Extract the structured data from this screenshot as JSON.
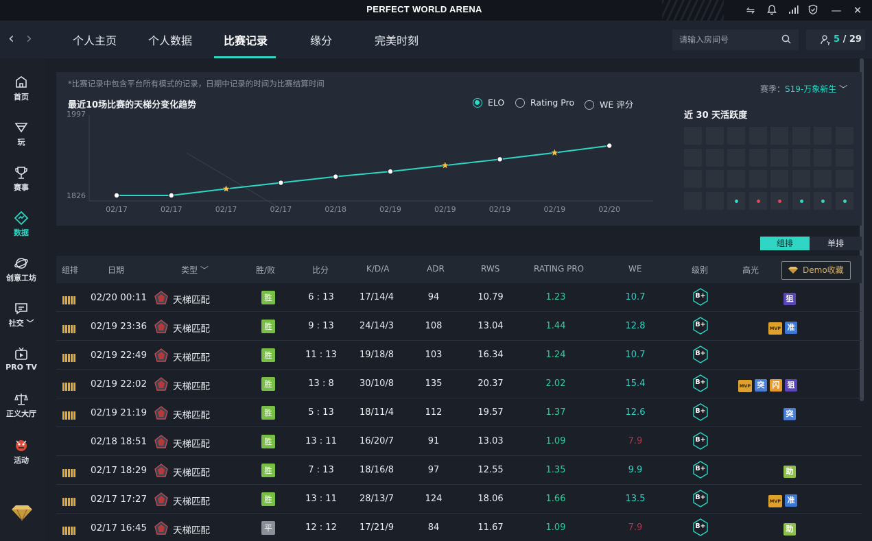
{
  "window": {
    "title": "PERFECT WORLD ARENA"
  },
  "nav": {
    "tabs": [
      {
        "label": "个人主页"
      },
      {
        "label": "个人数据"
      },
      {
        "label": "比赛记录"
      },
      {
        "label": "缘分"
      },
      {
        "label": "完美时刻"
      }
    ],
    "active_tab": "比赛记录",
    "room_search_placeholder": "请输入房间号",
    "online_count": "5",
    "online_total": "29"
  },
  "sidebar": {
    "items": [
      {
        "label": "首页",
        "icon": "home-icon"
      },
      {
        "label": "玩",
        "icon": "play-icon"
      },
      {
        "label": "赛事",
        "icon": "trophy-icon"
      },
      {
        "label": "数据",
        "icon": "data-icon"
      },
      {
        "label": "创意工坊",
        "icon": "workshop-icon"
      },
      {
        "label": "社交",
        "icon": "chat-icon"
      },
      {
        "label": "PRO TV",
        "icon": "tv-icon"
      },
      {
        "label": "正义大厅",
        "icon": "scales-icon"
      },
      {
        "label": "活动",
        "icon": "event-icon"
      }
    ],
    "active": "数据"
  },
  "chart_panel": {
    "note": "*比赛记录中包含平台所有模式的记录，日期中记录的时间为比赛结算时间",
    "title": "最近10场比赛的天梯分变化趋势",
    "radio_options": [
      "ELO",
      "Rating Pro",
      "WE 评分"
    ],
    "radio_selected": "ELO",
    "season_label": "赛季：",
    "season_value": "S19-万象新生",
    "activity_title": "近 30 天活跃度",
    "activity_cells": [
      "none",
      "none",
      "none",
      "none",
      "none",
      "none",
      "none",
      "none",
      "none",
      "none",
      "none",
      "none",
      "none",
      "none",
      "none",
      "none",
      "none",
      "none",
      "none",
      "none",
      "none",
      "none",
      "none",
      "none",
      "none",
      "none",
      "green",
      "red",
      "red",
      "green",
      "green",
      "green"
    ],
    "colors": {
      "accent": "#2ed6c3",
      "win_dot": "#2ed6c3",
      "loss_dot": "#e0475a"
    }
  },
  "chart_data": {
    "type": "line",
    "title": "最近10场比赛的天梯分变化趋势",
    "x": [
      "02/17",
      "02/17",
      "02/17",
      "02/17",
      "02/18",
      "02/19",
      "02/19",
      "02/19",
      "02/19",
      "02/20"
    ],
    "series": [
      {
        "values": [
          1826,
          1826,
          1840,
          1853,
          1866,
          1877,
          1890,
          1903,
          1917,
          1932
        ],
        "stars": [
          false,
          false,
          true,
          false,
          false,
          false,
          true,
          false,
          true,
          false
        ]
      }
    ],
    "y_tick_labels": [
      "1997",
      "1826"
    ],
    "ylim": [
      1826,
      1997
    ]
  },
  "mode_toggle": {
    "options": [
      "组排",
      "单排"
    ],
    "selected": "组排"
  },
  "table": {
    "headers": {
      "group": "组排",
      "date": "日期",
      "type": "类型",
      "result": "胜/败",
      "score": "比分",
      "kda": "K/D/A",
      "adr": "ADR",
      "rws": "RWS",
      "rating": "RATING PRO",
      "we": "WE",
      "level": "级别",
      "highlight": "高光"
    },
    "demo_button": "Demo收藏",
    "rows": [
      {
        "group": true,
        "date": "02/20 00:11",
        "type": "天梯匹配",
        "result": "胜",
        "score": "6 : 13",
        "kda": "17/14/4",
        "adr": "94",
        "rws": "10.79",
        "rating": "1.23",
        "we": "10.7",
        "we_low": false,
        "level": "B+",
        "tags": [
          {
            "t": "zu",
            "label": "狙"
          }
        ]
      },
      {
        "group": true,
        "date": "02/19 23:36",
        "type": "天梯匹配",
        "result": "胜",
        "score": "9 : 13",
        "kda": "24/14/3",
        "adr": "108",
        "rws": "13.04",
        "rating": "1.44",
        "we": "12.8",
        "we_low": false,
        "level": "B+",
        "tags": [
          {
            "t": "mvp",
            "label": "MVP"
          },
          {
            "t": "yan",
            "label": "准"
          }
        ]
      },
      {
        "group": true,
        "date": "02/19 22:49",
        "type": "天梯匹配",
        "result": "胜",
        "score": "11 : 13",
        "kda": "19/18/8",
        "adr": "103",
        "rws": "16.34",
        "rating": "1.24",
        "we": "10.7",
        "we_low": false,
        "level": "B+",
        "tags": []
      },
      {
        "group": true,
        "date": "02/19 22:02",
        "type": "天梯匹配",
        "result": "胜",
        "score": "13 : 8",
        "kda": "30/10/8",
        "adr": "135",
        "rws": "20.37",
        "rating": "2.02",
        "we": "15.4",
        "we_low": false,
        "level": "B+",
        "tags": [
          {
            "t": "mvp",
            "label": "MVP"
          },
          {
            "t": "tu",
            "label": "突"
          },
          {
            "t": "shan",
            "label": "闪"
          },
          {
            "t": "zu",
            "label": "狙"
          }
        ]
      },
      {
        "group": true,
        "date": "02/19 21:19",
        "type": "天梯匹配",
        "result": "胜",
        "score": "5 : 13",
        "kda": "18/11/4",
        "adr": "112",
        "rws": "19.57",
        "rating": "1.37",
        "we": "12.6",
        "we_low": false,
        "level": "B+",
        "tags": [
          {
            "t": "tu",
            "label": "突"
          }
        ]
      },
      {
        "group": false,
        "date": "02/18 18:51",
        "type": "天梯匹配",
        "result": "胜",
        "score": "13 : 11",
        "kda": "16/20/7",
        "adr": "91",
        "rws": "13.03",
        "rating": "1.09",
        "we": "7.9",
        "we_low": true,
        "level": "B+",
        "tags": []
      },
      {
        "group": true,
        "date": "02/17 18:29",
        "type": "天梯匹配",
        "result": "胜",
        "score": "7 : 13",
        "kda": "18/16/8",
        "adr": "97",
        "rws": "12.55",
        "rating": "1.35",
        "we": "9.9",
        "we_low": false,
        "level": "B+",
        "tags": [
          {
            "t": "zhu",
            "label": "助"
          }
        ]
      },
      {
        "group": true,
        "date": "02/17 17:27",
        "type": "天梯匹配",
        "result": "胜",
        "score": "13 : 11",
        "kda": "28/13/7",
        "adr": "124",
        "rws": "18.06",
        "rating": "1.66",
        "we": "13.5",
        "we_low": false,
        "level": "B+",
        "tags": [
          {
            "t": "mvp",
            "label": "MVP"
          },
          {
            "t": "yan",
            "label": "准"
          }
        ]
      },
      {
        "group": true,
        "date": "02/17 16:45",
        "type": "天梯匹配",
        "result": "平",
        "score": "12 : 12",
        "kda": "17/21/9",
        "adr": "84",
        "rws": "11.67",
        "rating": "1.09",
        "we": "7.9",
        "we_low": true,
        "level": "B+",
        "tags": [
          {
            "t": "zhu",
            "label": "助"
          }
        ]
      }
    ]
  }
}
